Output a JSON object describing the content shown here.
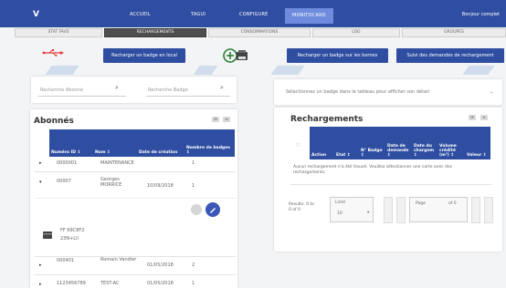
{
  "header": {
    "logo": "V",
    "nav": [
      "ACCUEIL",
      "TAGUI",
      "CONFIGURE",
      "MONITOCARD"
    ],
    "user": "Bonjour complet"
  },
  "subnav": [
    "STAT FAVS",
    "RECHARGEMENTS",
    "CONSOMMATIONS",
    "LOG",
    "GROUPES"
  ],
  "actions": {
    "recharge_local": "Recharger un badge en local",
    "recharge_bornes": "Recharger un badge sur les bornes",
    "suivi": "Suivi des demandes de rechargement"
  },
  "search": {
    "abonne": "Recherche Abonné",
    "badge": "Recherche Badge",
    "select_badge": "Sélectionnez un badge dans le tableau pour afficher son détail"
  },
  "abonnes": {
    "title": "Abonnés",
    "headers": [
      "Numéro ID ↕",
      "Nom ↕",
      "Date de création",
      "Nombre de badges ↕"
    ],
    "rows": [
      {
        "id": "0000001",
        "nom": "MAINTENANCE",
        "date": "",
        "badges": "1"
      },
      {
        "id": "00007",
        "nom": "Georges MORRICE",
        "date": "10/09/2018",
        "badges": "1"
      },
      {
        "id": "000401",
        "nom": "Romain Vandier",
        "date": "01/05/2018",
        "badges": "2"
      },
      {
        "id": "1123456789",
        "nom": "TEST-AC",
        "date": "01/05/2018",
        "badges": "1"
      }
    ],
    "badge_detail": {
      "line1": "FF 69C8F2",
      "line2": "23N+Lll"
    }
  },
  "rechargements": {
    "title": "Rechargements",
    "headers": [
      "Action",
      "Etat ↕",
      "N° Badge ↕",
      "Date de demande ↕",
      "Date du chargem ↕",
      "Volume crédité (m³) ↕",
      "Valeur ↕"
    ],
    "empty_message": "Aucun rechargement n'a été trouvé. Veuillez sélectionner une carte avec des rechargements.",
    "results": "Results: 0 to 0 of 0",
    "limit_label": "Limit",
    "limit_value": "10",
    "page_label": "Page",
    "of_label": "of 0"
  },
  "colors": {
    "primary": "#2f4ea1",
    "active_nav": "#6f8bdd"
  },
  "icons": [
    "usb-icon",
    "badge-add-icon",
    "search-icon",
    "edit-icon",
    "delete-icon",
    "card-icon"
  ]
}
